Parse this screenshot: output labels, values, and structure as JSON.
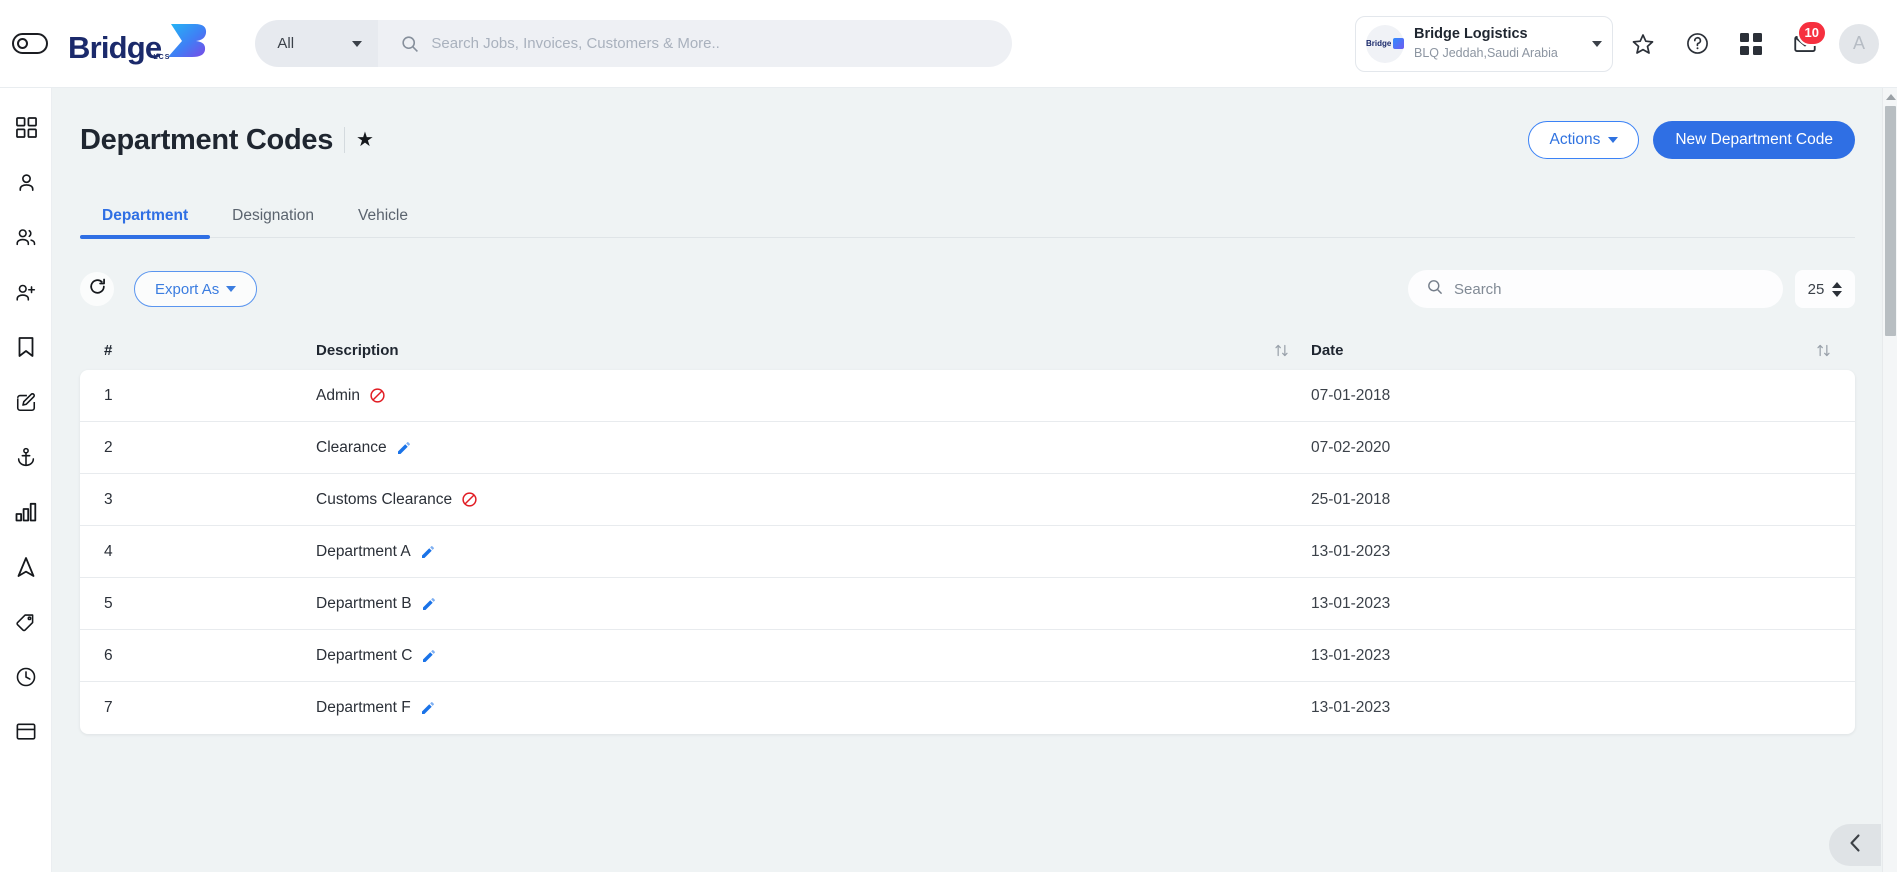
{
  "topbar": {
    "toggle_icon": "sidebar-toggle-icon",
    "brand_word": "Bridge",
    "brand_sub": "LCS",
    "search_scope": "All",
    "search_placeholder": "Search Jobs, Invoices, Customers & More..",
    "org_logo_text": "Bridge",
    "org_name": "Bridge Logistics",
    "org_location": "BLQ Jeddah,Saudi Arabia",
    "icons": [
      "star-icon",
      "help-circle-icon",
      "apps-grid-icon",
      "mail-icon"
    ],
    "mail_badge": "10",
    "avatar_initial": "A"
  },
  "sidebar": {
    "items": [
      {
        "name": "dashboard-grid-icon"
      },
      {
        "name": "person-icon"
      },
      {
        "name": "people-icon"
      },
      {
        "name": "person-add-icon"
      },
      {
        "name": "bookmark-icon"
      },
      {
        "name": "edit-square-icon"
      },
      {
        "name": "anchor-icon"
      },
      {
        "name": "bar-chart-icon"
      },
      {
        "name": "navigation-arrow-icon"
      },
      {
        "name": "tag-icon"
      },
      {
        "name": "clock-icon"
      },
      {
        "name": "window-icon"
      }
    ]
  },
  "page": {
    "title": "Department Codes",
    "favorite_star": "★",
    "actions_label": "Actions",
    "new_label": "New Department Code"
  },
  "tabs": [
    {
      "label": "Department",
      "active": true
    },
    {
      "label": "Designation",
      "active": false
    },
    {
      "label": "Vehicle",
      "active": false
    }
  ],
  "toolbar": {
    "refresh_icon": "refresh-icon",
    "export_label": "Export As",
    "search_placeholder": "Search",
    "search_value": "",
    "page_size": "25"
  },
  "table": {
    "columns": [
      "#",
      "Description",
      "Date"
    ],
    "rows": [
      {
        "num": "1",
        "description": "Admin",
        "icon": "blocked",
        "date": "07-01-2018"
      },
      {
        "num": "2",
        "description": "Clearance",
        "icon": "edit",
        "date": "07-02-2020"
      },
      {
        "num": "3",
        "description": "Customs Clearance",
        "icon": "blocked",
        "date": "25-01-2018"
      },
      {
        "num": "4",
        "description": "Department A",
        "icon": "edit",
        "date": "13-01-2023"
      },
      {
        "num": "5",
        "description": "Department B",
        "icon": "edit",
        "date": "13-01-2023"
      },
      {
        "num": "6",
        "description": "Department C",
        "icon": "edit",
        "date": "13-01-2023"
      },
      {
        "num": "7",
        "description": "Department F",
        "icon": "edit",
        "date": "13-01-2023"
      }
    ]
  },
  "colors": {
    "primary": "#2f6fe4",
    "brand_navy": "#1b2a6b",
    "danger": "#f6303f",
    "edit_blue": "#1a73e8",
    "page_bg": "#eff3f4"
  }
}
